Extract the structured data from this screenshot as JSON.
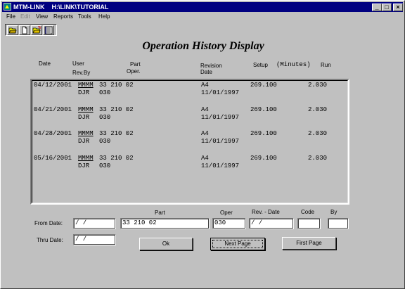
{
  "window": {
    "title": "MTM-LINK    H:\\LINK\\TUTORIAL",
    "minimize": "_",
    "maximize": "□",
    "close": "×"
  },
  "menu": [
    {
      "label": "File",
      "enabled": true
    },
    {
      "label": "Edit",
      "enabled": false
    },
    {
      "label": "View",
      "enabled": true
    },
    {
      "label": "Reports",
      "enabled": true
    },
    {
      "label": "Tools",
      "enabled": true
    },
    {
      "label": "Help",
      "enabled": true
    }
  ],
  "toolbar": {
    "icons": [
      "open-folder-icon",
      "new-document-icon",
      "open-file-icon",
      "list-icon"
    ]
  },
  "page_title": "Operation History Display",
  "columns": {
    "date": "Date",
    "user": "User",
    "revby": "Rev.By",
    "part": "Part",
    "oper": "Oper.",
    "revision": "Revision",
    "revdate": "Date",
    "setup": "Setup",
    "minutes": "(Minutes)",
    "run": "Run"
  },
  "records": [
    {
      "date": "04/12/2001",
      "user": "MMMM",
      "part": "33 210 02",
      "revby": "DJR",
      "oper": "030",
      "revision": "A4",
      "revdate": "11/01/1997",
      "setup": "269.100",
      "run": "2.030"
    },
    {
      "date": "04/21/2001",
      "user": "MMMM",
      "part": "33 210 02",
      "revby": "DJR",
      "oper": "030",
      "revision": "A4",
      "revdate": "11/01/1997",
      "setup": "269.100",
      "run": "2.030"
    },
    {
      "date": "04/28/2001",
      "user": "MMMM",
      "part": "33 210 02",
      "revby": "DJR",
      "oper": "030",
      "revision": "A4",
      "revdate": "11/01/1997",
      "setup": "269.100",
      "run": "2.030"
    },
    {
      "date": "05/16/2001",
      "user": "MMMM",
      "part": "33 210 02",
      "revby": "DJR",
      "oper": "030",
      "revision": "A4",
      "revdate": "11/01/1997",
      "setup": "269.100",
      "run": "2.030"
    }
  ],
  "filter": {
    "part_label": "Part",
    "oper_label": "Oper",
    "revdate_label": "Rev. - Date",
    "code_label": "Code",
    "by_label": "By",
    "from_label": "From Date:",
    "thru_label": "Thru Date:",
    "from_value": " /  /",
    "thru_value": " /  /",
    "part_value": "33 210 02",
    "oper_value": "030",
    "revdate_value": " /  /",
    "code_value": "",
    "by_value": ""
  },
  "buttons": {
    "ok": "Ok",
    "next_page": "Next Page",
    "first_page": "First Page"
  }
}
